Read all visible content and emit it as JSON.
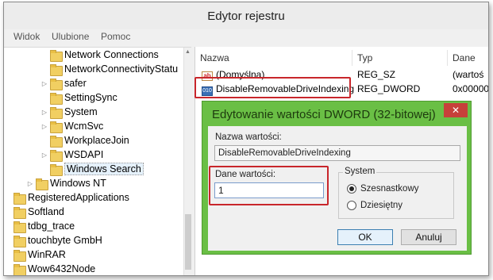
{
  "window": {
    "title": "Edytor rejestru"
  },
  "menu": [
    "Widok",
    "Ulubione",
    "Pomoc"
  ],
  "tree": {
    "items": [
      {
        "label": "Network Connections",
        "expander": ""
      },
      {
        "label": "NetworkConnectivityStatu",
        "expander": ""
      },
      {
        "label": "safer",
        "expander": "▷"
      },
      {
        "label": "SettingSync",
        "expander": ""
      },
      {
        "label": "System",
        "expander": "▷"
      },
      {
        "label": "WcmSvc",
        "expander": "▷"
      },
      {
        "label": "WorkplaceJoin",
        "expander": ""
      },
      {
        "label": "WSDAPI",
        "expander": "▷"
      },
      {
        "label": "Windows Search",
        "expander": ""
      },
      {
        "label": "Windows NT",
        "expander": "▷"
      },
      {
        "label": "RegisteredApplications",
        "expander": ""
      },
      {
        "label": "Softland",
        "expander": ""
      },
      {
        "label": "tdbg_trace",
        "expander": ""
      },
      {
        "label": "touchbyte GmbH",
        "expander": ""
      },
      {
        "label": "WinRAR",
        "expander": ""
      },
      {
        "label": "Wow6432Node",
        "expander": ""
      }
    ]
  },
  "list": {
    "columns": [
      "Nazwa",
      "Typ",
      "Dane"
    ],
    "rows": [
      {
        "icon": "ab",
        "name": "(Domyślna)",
        "type": "REG_SZ",
        "data": "(wartoś"
      },
      {
        "icon": "bin",
        "name": "DisableRemovableDriveIndexing",
        "type": "REG_DWORD",
        "data": "0x000000"
      }
    ]
  },
  "dialog": {
    "title": "Edytowanie wartości DWORD (32-bitowej)",
    "close": "✕",
    "name_label": "Nazwa wartości:",
    "name_value": "DisableRemovableDriveIndexing",
    "data_label": "Dane wartości:",
    "data_value": "1",
    "system_label": "System",
    "radio_hex": "Szesnastkowy",
    "radio_dec": "Dziesiętny",
    "ok": "OK",
    "cancel": "Anuluj"
  },
  "colors": {
    "dialog_frame": "#6abf45",
    "highlight": "#c8262b"
  }
}
